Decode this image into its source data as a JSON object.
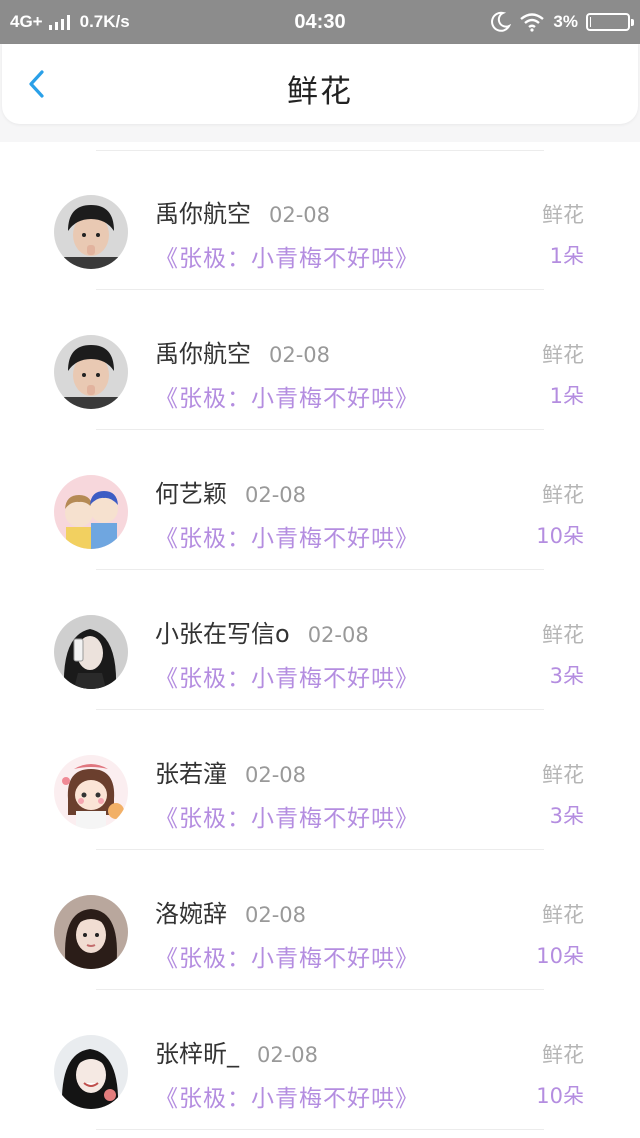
{
  "status_bar": {
    "network": "4G+",
    "speed": "0.7K/s",
    "time": "04:30",
    "battery": "3%",
    "battery_level": 0.03
  },
  "header": {
    "title": "鲜花"
  },
  "colors": {
    "accent_purple": "#b48de0",
    "back_blue": "#2aa0e8"
  },
  "list": {
    "items": [
      {
        "name": "禹你航空",
        "date": "02-08",
        "book": "《张极：小青梅不好哄》",
        "gift": "鲜花",
        "count": "1朵",
        "avatar": "avatar-boy"
      },
      {
        "name": "禹你航空",
        "date": "02-08",
        "book": "《张极：小青梅不好哄》",
        "gift": "鲜花",
        "count": "1朵",
        "avatar": "avatar-boy"
      },
      {
        "name": "何艺颖",
        "date": "02-08",
        "book": "《张极：小青梅不好哄》",
        "gift": "鲜花",
        "count": "10朵",
        "avatar": "avatar-cartoon-pair"
      },
      {
        "name": "小张在写信o",
        "date": "02-08",
        "book": "《张极：小青梅不好哄》",
        "gift": "鲜花",
        "count": "3朵",
        "avatar": "avatar-girl-selfie"
      },
      {
        "name": "张若潼",
        "date": "02-08",
        "book": "《张极：小青梅不好哄》",
        "gift": "鲜花",
        "count": "3朵",
        "avatar": "avatar-cartoon-girl"
      },
      {
        "name": "洛婉辞",
        "date": "02-08",
        "book": "《张极：小青梅不好哄》",
        "gift": "鲜花",
        "count": "10朵",
        "avatar": "avatar-girl-portrait"
      },
      {
        "name": "张梓昕_",
        "date": "02-08",
        "book": "《张极：小青梅不好哄》",
        "gift": "鲜花",
        "count": "10朵",
        "avatar": "avatar-girl-smile"
      }
    ]
  }
}
